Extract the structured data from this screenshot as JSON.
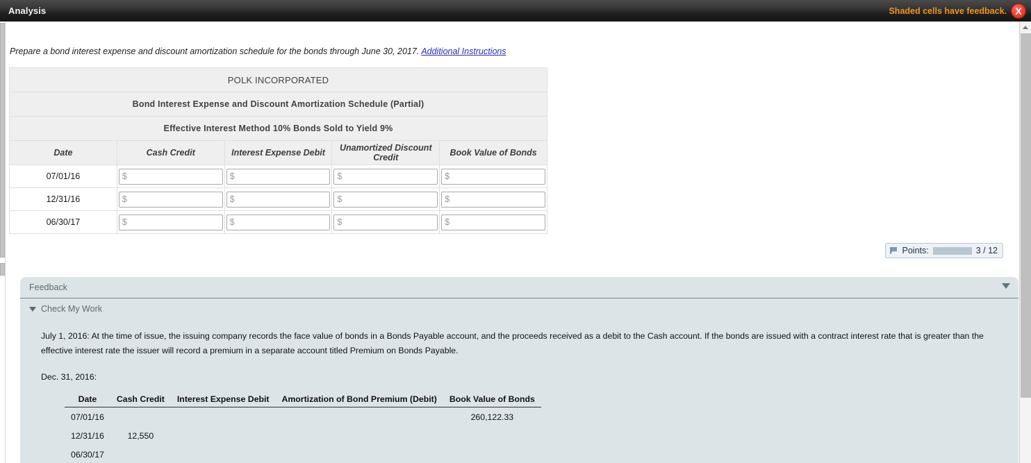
{
  "window": {
    "title": "Analysis",
    "shaded_note": "Shaded cells have feedback.",
    "close_label": "X"
  },
  "instructions": {
    "text": "Prepare a bond interest expense and discount amortization schedule for the bonds through June 30, 2017.",
    "link_label": "Additional Instructions"
  },
  "schedule": {
    "company": "POLK INCORPORATED",
    "subtitle": "Bond Interest Expense and Discount Amortization Schedule (Partial)",
    "method": "Effective Interest Method 10% Bonds Sold to Yield 9%",
    "columns": [
      "Date",
      "Cash Credit",
      "Interest Expense Debit",
      "Unamortized Discount Credit",
      "Book Value of Bonds"
    ],
    "input_placeholder": "$",
    "rows": [
      {
        "date": "07/01/16",
        "cash_credit": "",
        "interest_expense_debit": "",
        "unamortized_discount_credit": "",
        "book_value": ""
      },
      {
        "date": "12/31/16",
        "cash_credit": "",
        "interest_expense_debit": "",
        "unamortized_discount_credit": "",
        "book_value": ""
      },
      {
        "date": "06/30/17",
        "cash_credit": "",
        "interest_expense_debit": "",
        "unamortized_discount_credit": "",
        "book_value": ""
      }
    ]
  },
  "points": {
    "label": "Points:",
    "value": "3 / 12",
    "earned": 3,
    "total": 12,
    "percent": 25,
    "fill_color": "#2f73b8",
    "track_color": "#b8c6d2"
  },
  "feedback": {
    "panel_title": "Feedback",
    "check_my_work": "Check My Work",
    "paragraph": "July 1, 2016: At the time of issue, the issuing company records the face value of bonds in a Bonds Payable account, and the proceeds received as a debit to the Cash account. If the bonds are issued with a contract interest rate that is greater than the effective interest rate the issuer will record a premium in a separate account titled Premium on Bonds Payable.",
    "sub_heading": "Dec. 31, 2016:",
    "table": {
      "columns": [
        "Date",
        "Cash Credit",
        "Interest Expense Debit",
        "Amortization of Bond Premium (Debit)",
        "Book Value of Bonds"
      ],
      "rows": [
        {
          "date": "07/01/16",
          "cash_credit": "",
          "interest_expense_debit": "",
          "amortization": "",
          "book_value": "260,122.33"
        },
        {
          "date": "12/31/16",
          "cash_credit": "12,550",
          "interest_expense_debit": "",
          "amortization": "",
          "book_value": ""
        },
        {
          "date": "06/30/17",
          "cash_credit": "",
          "interest_expense_debit": "",
          "amortization": "",
          "book_value": ""
        }
      ]
    }
  }
}
